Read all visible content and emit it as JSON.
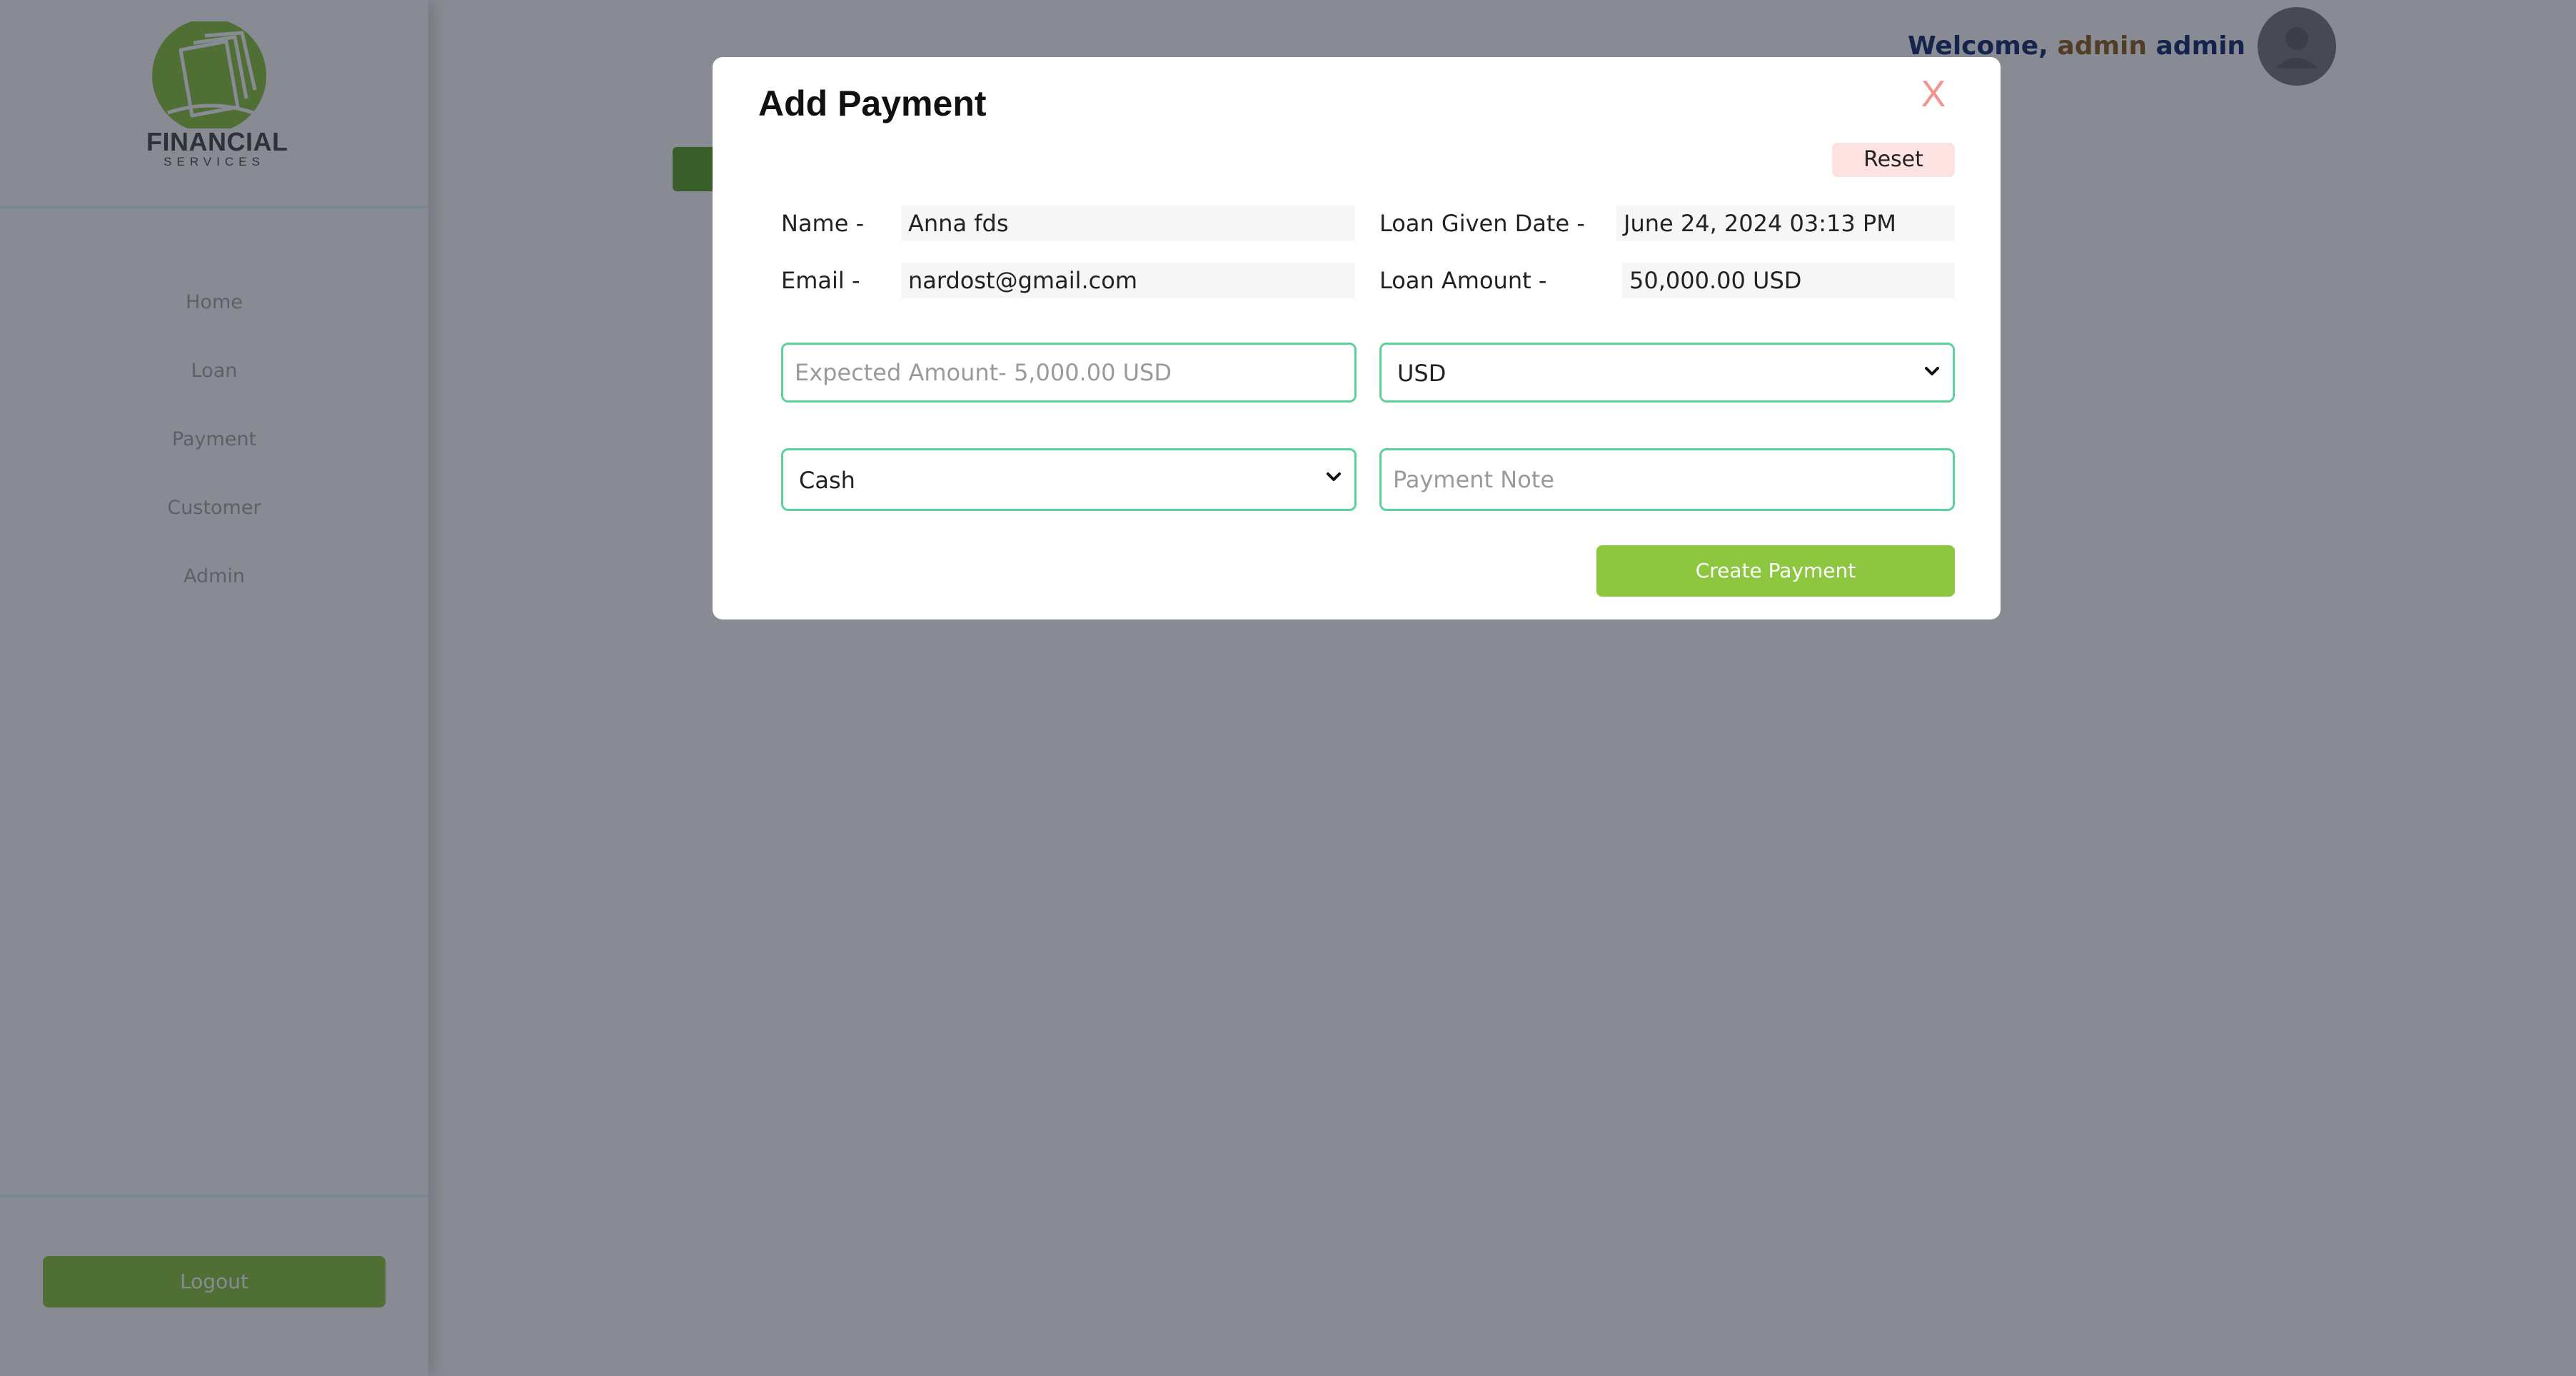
{
  "brand": {
    "logo_word": "FINANCIAL",
    "logo_sub": "SERVICES",
    "logo_color": "#8dc63f"
  },
  "sidebar": {
    "items": [
      {
        "label": "Home"
      },
      {
        "label": "Loan"
      },
      {
        "label": "Payment"
      },
      {
        "label": "Customer"
      },
      {
        "label": "Admin"
      }
    ],
    "logout_label": "Logout"
  },
  "header": {
    "welcome_label": "Welcome,",
    "user_first": "admin",
    "user_last": "admin"
  },
  "modal": {
    "title": "Add Payment",
    "close_label": "X",
    "reset_label": "Reset",
    "info": {
      "name_label": "Name -",
      "name_value": "Anna fds",
      "email_label": "Email -",
      "email_value": "nardost@gmail.com",
      "date_label": "Loan Given Date -",
      "date_value": "June 24, 2024 03:13 PM",
      "amount_label": "Loan Amount -",
      "amount_value": "50,000.00 USD"
    },
    "expected_amount": {
      "value": "",
      "placeholder": "Expected Amount- 5,000.00 USD"
    },
    "currency_select": {
      "selected": "USD"
    },
    "method_select": {
      "selected": "Cash"
    },
    "payment_note": {
      "value": "",
      "placeholder": "Payment Note"
    },
    "create_label": "Create Payment"
  },
  "colors": {
    "accent": "#8dc63f",
    "input_border": "#5ad39a",
    "close": "#f2958c",
    "reset_bg": "#fde2e2",
    "overlay": "rgba(20, 24, 42, 0.50)"
  }
}
